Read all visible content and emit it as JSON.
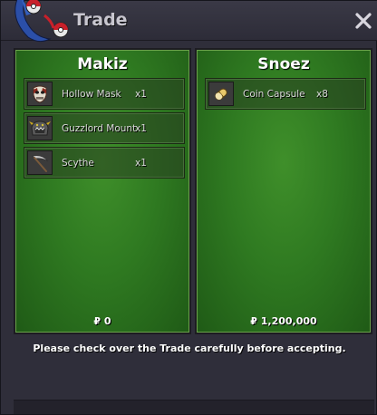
{
  "window": {
    "title": "Trade"
  },
  "left_player": {
    "name": "Makiz",
    "items": [
      {
        "name": "Hollow Mask",
        "qty": "x1",
        "icon": "hollow-mask-icon"
      },
      {
        "name": "Guzzlord Mount",
        "qty": "x1",
        "icon": "guzzlord-mount-icon"
      },
      {
        "name": "Scythe",
        "qty": "x1",
        "icon": "scythe-icon"
      }
    ],
    "money": "₽ 0"
  },
  "right_player": {
    "name": "Snoez",
    "items": [
      {
        "name": "Coin Capsule",
        "qty": "x8",
        "icon": "coin-capsule-icon"
      }
    ],
    "money": "₽ 1,200,000"
  },
  "notice": "Please check over the Trade carefully before accepting.",
  "colors": {
    "panel_green": "#2f7a21",
    "window_bg": "#2f2e3a",
    "accent_red": "#c8202a"
  }
}
